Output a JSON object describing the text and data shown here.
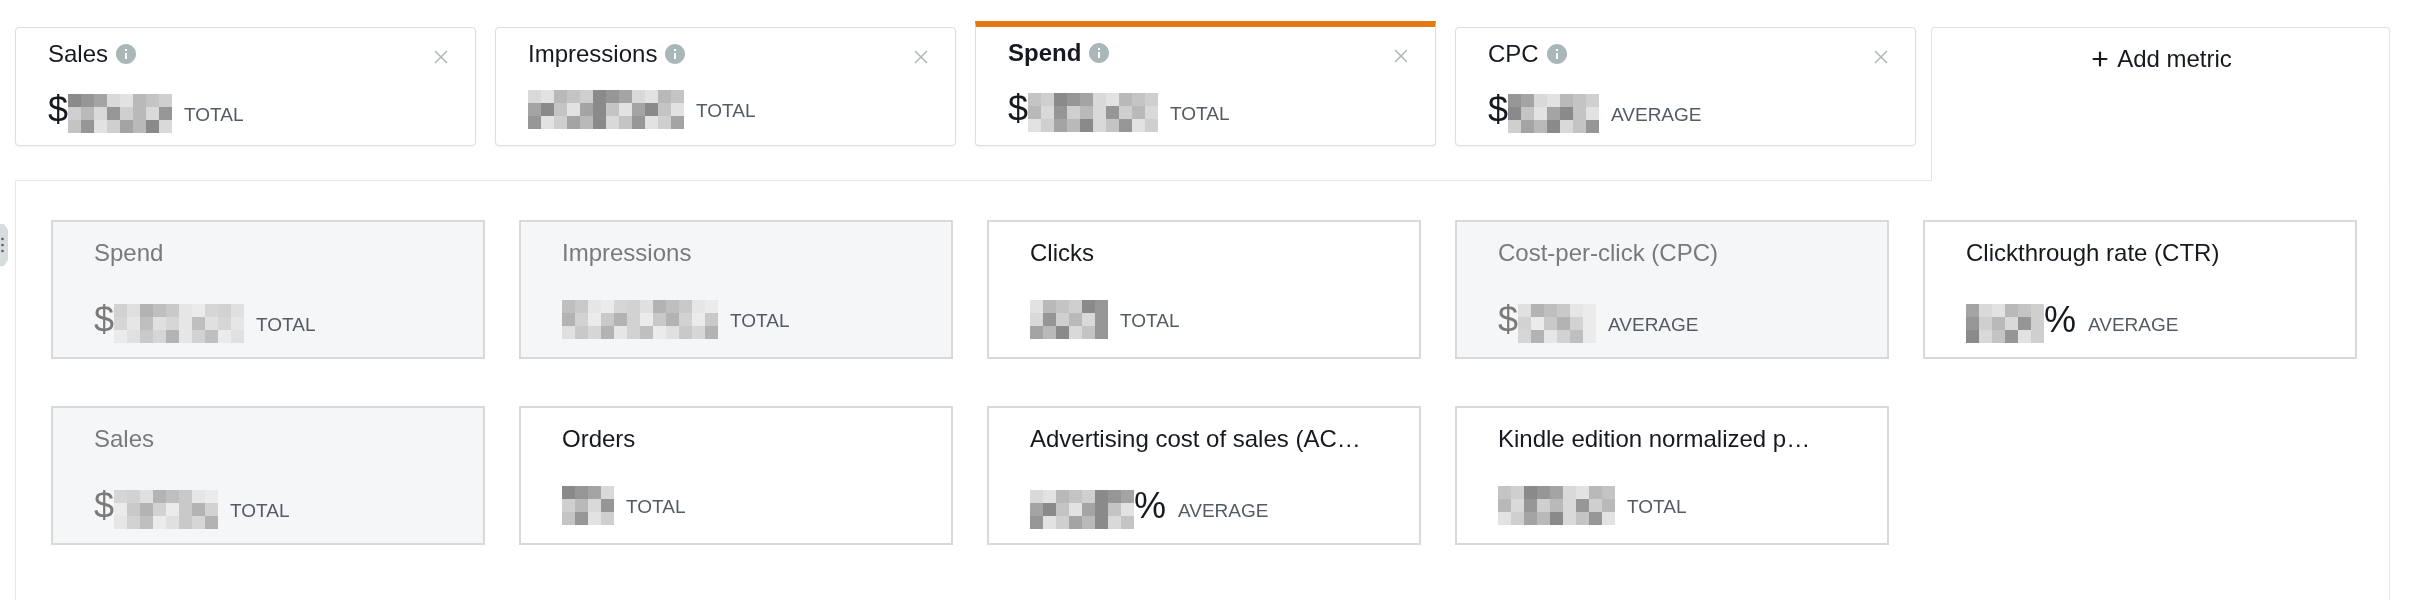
{
  "metric_tabs": [
    {
      "title": "Sales",
      "selected": false,
      "prefix": "$",
      "aggregate": "TOTAL"
    },
    {
      "title": "Impressions",
      "selected": false,
      "aggregate": "TOTAL"
    },
    {
      "title": "Spend",
      "selected": true,
      "prefix": "$",
      "aggregate": "TOTAL"
    },
    {
      "title": "CPC",
      "selected": false,
      "prefix": "$",
      "aggregate": "AVERAGE"
    }
  ],
  "add_metric": {
    "label": "Add metric"
  },
  "metric_cards": [
    {
      "title": "Spend",
      "disabled": true,
      "prefix": "$",
      "aggregate": "TOTAL"
    },
    {
      "title": "Impressions",
      "disabled": true,
      "aggregate": "TOTAL"
    },
    {
      "title": "Clicks",
      "disabled": false,
      "aggregate": "TOTAL"
    },
    {
      "title": "Cost-per-click (CPC)",
      "disabled": true,
      "prefix": "$",
      "aggregate": "AVERAGE"
    },
    {
      "title": "Clickthrough rate (CTR)",
      "disabled": false,
      "suffix": "%",
      "aggregate": "AVERAGE"
    },
    {
      "title": "Sales",
      "disabled": true,
      "prefix": "$",
      "aggregate": "TOTAL"
    },
    {
      "title": "Orders",
      "disabled": false,
      "aggregate": "TOTAL"
    },
    {
      "title": "Advertising cost of sales (AC…",
      "disabled": false,
      "suffix": "%",
      "aggregate": "AVERAGE"
    },
    {
      "title": "Kindle edition normalized p…",
      "disabled": false,
      "aggregate": "TOTAL"
    }
  ]
}
